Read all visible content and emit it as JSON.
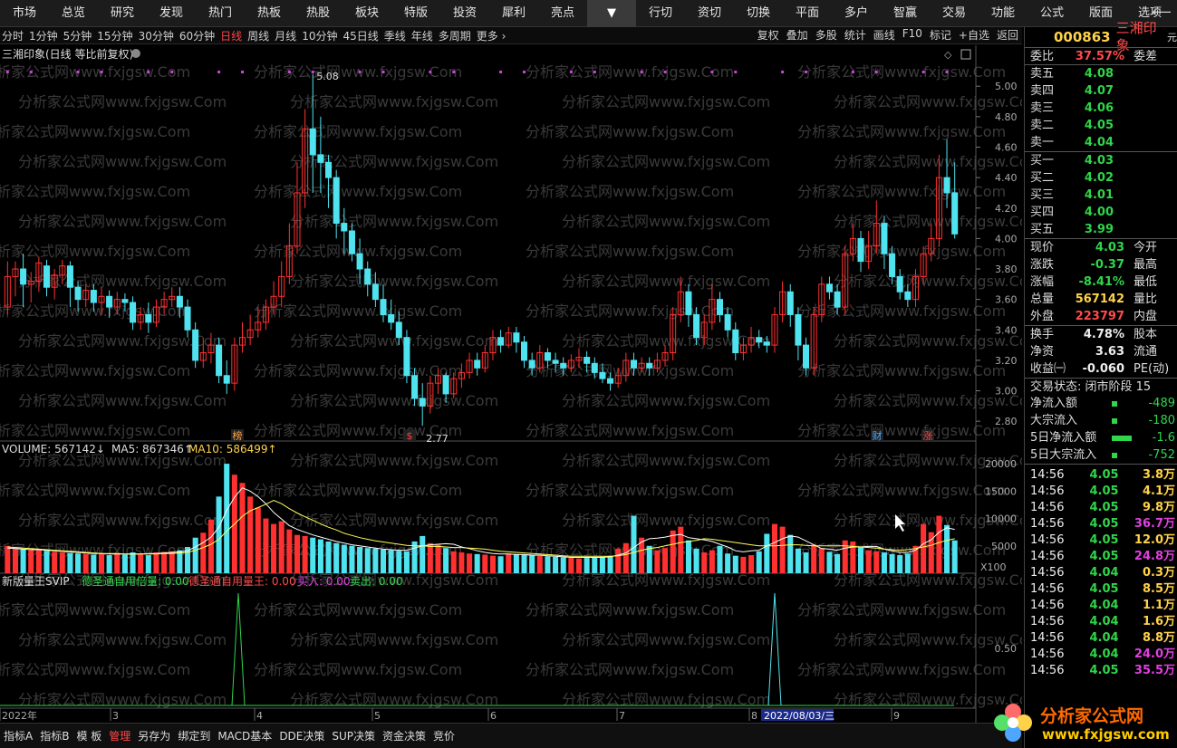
{
  "menu": [
    "市场",
    "总览",
    "研究",
    "发现",
    "热门",
    "热板",
    "热股",
    "板块",
    "特版",
    "投资",
    "犀利",
    "亮点",
    "▼",
    "行切",
    "资切",
    "切换",
    "平面",
    "多户",
    "智赢",
    "交易",
    "功能",
    "公式",
    "版面",
    "选项"
  ],
  "periods": [
    "分时",
    "1分钟",
    "5分钟",
    "15分钟",
    "30分钟",
    "60分钟",
    "日线",
    "周线",
    "月线",
    "10分钟",
    "45日线",
    "季线",
    "年线",
    "多周期",
    "更多 ›"
  ],
  "active_period": "日线",
  "period_right": [
    "复权",
    "叠加",
    "多股",
    "统计",
    "画线",
    "F10",
    "标记",
    "+自选",
    "返回"
  ],
  "title": "三湘印象(日线 等比前复权)",
  "watermark": "分析家公式网www.fxjgsw.Com",
  "markers": {
    "hi": "5.08",
    "lo": "2.77",
    "m1": "榜",
    "m2": "$",
    "m3": "财",
    "m4": "涨"
  },
  "volume_legend": {
    "vol": "VOLUME: 567142↓",
    "ma5": "MA5: 867346↑",
    "ma10": "MA10: 586499↑"
  },
  "x100": "X100",
  "ind_legend": {
    "name": "新版量王SVIP",
    "a": "德圣通自用倍量: 0.00",
    "b": "德圣通自用量王: 0.00",
    "c": "买入: 0.00",
    "d": "卖出: 0.00"
  },
  "ind_tick": "0.50",
  "xaxis": {
    "y": "2022年",
    "m3": "3",
    "m4": "4",
    "m5": "5",
    "m6": "6",
    "m7": "7",
    "m8": "8",
    "m9": "9",
    "date": "2022/08/03/三"
  },
  "price_ticks": [
    "5.00",
    "4.80",
    "4.60",
    "4.40",
    "4.20",
    "4.00",
    "3.80",
    "3.60",
    "3.40",
    "3.20",
    "3.00",
    "2.80"
  ],
  "vol_ticks": [
    "20000",
    "15000",
    "10000",
    "5000"
  ],
  "bottom": [
    "指标A",
    "指标B",
    "模 板",
    "管理",
    "另存为",
    "绑定到",
    "MACD基本",
    "DDE决策",
    "SUP决策",
    "资金决策",
    "竞价"
  ],
  "bottom_active": "管理",
  "quote": {
    "code": "000863",
    "name": "三湘印象",
    "unit": "元",
    "wb_l": "委比",
    "wb_v": "37.57%",
    "wc_l": "委差",
    "asks": [
      {
        "l": "卖五",
        "p": "4.08"
      },
      {
        "l": "卖四",
        "p": "4.07"
      },
      {
        "l": "卖三",
        "p": "4.06"
      },
      {
        "l": "卖二",
        "p": "4.05"
      },
      {
        "l": "卖一",
        "p": "4.04"
      }
    ],
    "bids": [
      {
        "l": "买一",
        "p": "4.03"
      },
      {
        "l": "买二",
        "p": "4.02"
      },
      {
        "l": "买三",
        "p": "4.01"
      },
      {
        "l": "买四",
        "p": "4.00"
      },
      {
        "l": "买五",
        "p": "3.99"
      }
    ],
    "stats": [
      {
        "l": "现价",
        "v": "4.03",
        "c": "g",
        "r": "今开"
      },
      {
        "l": "涨跌",
        "v": "-0.37",
        "c": "g",
        "r": "最高"
      },
      {
        "l": "涨幅",
        "v": "-8.41%",
        "c": "g",
        "r": "最低"
      },
      {
        "l": "总量",
        "v": "567142",
        "c": "y",
        "r": "量比"
      },
      {
        "l": "外盘",
        "v": "223797",
        "c": "r",
        "r": "内盘"
      },
      {
        "l": "换手",
        "v": "4.78%",
        "c": "w",
        "r": "股本"
      },
      {
        "l": "净资",
        "v": "3.63",
        "c": "w",
        "r": "流通"
      },
      {
        "l": "收益㈠",
        "v": "-0.060",
        "c": "w",
        "r": "PE(动)"
      }
    ],
    "status": "交易状态: 闭市阶段 15",
    "flows": [
      {
        "l": "净流入额",
        "v": "-489"
      },
      {
        "l": "大宗流入",
        "v": "-180"
      },
      {
        "l": "5日净流入额",
        "v": "-1.6"
      },
      {
        "l": "5日大宗流入",
        "v": "-752"
      }
    ],
    "ticks": [
      {
        "t": "14:56",
        "p": "4.05",
        "v": "3.8万",
        "c": "y"
      },
      {
        "t": "14:56",
        "p": "4.05",
        "v": "4.1万",
        "c": "y"
      },
      {
        "t": "14:56",
        "p": "4.05",
        "v": "9.8万",
        "c": "y"
      },
      {
        "t": "14:56",
        "p": "4.05",
        "v": "36.7万",
        "c": "m"
      },
      {
        "t": "14:56",
        "p": "4.05",
        "v": "12.0万",
        "c": "y"
      },
      {
        "t": "14:56",
        "p": "4.05",
        "v": "24.8万",
        "c": "m"
      },
      {
        "t": "14:56",
        "p": "4.04",
        "v": "0.3万",
        "c": "y"
      },
      {
        "t": "14:56",
        "p": "4.05",
        "v": "8.5万",
        "c": "y"
      },
      {
        "t": "14:56",
        "p": "4.04",
        "v": "1.1万",
        "c": "y"
      },
      {
        "t": "14:56",
        "p": "4.04",
        "v": "1.6万",
        "c": "y"
      },
      {
        "t": "14:56",
        "p": "4.04",
        "v": "8.8万",
        "c": "y"
      },
      {
        "t": "14:56",
        "p": "4.04",
        "v": "24.0万",
        "c": "m"
      },
      {
        "t": "14:56",
        "p": "4.05",
        "v": "35.5万",
        "c": "m"
      }
    ]
  },
  "logo": {
    "cn": "分析家公式网",
    "url": "www.fxjgsw.com"
  },
  "colors": {
    "up": "#ff3030",
    "down": "#4fe3f0",
    "ma5": "#ffffff",
    "ma10": "#ffd200",
    "volma10": "#ffff55"
  },
  "chart_data": {
    "type": "candlestick",
    "price_range": [
      2.7,
      5.15
    ],
    "candles": [
      [
        3.55,
        3.75,
        3.85,
        3.5
      ],
      [
        3.75,
        3.8,
        3.85,
        3.62
      ],
      [
        3.8,
        3.7,
        3.9,
        3.55
      ],
      [
        3.7,
        3.72,
        3.78,
        3.58
      ],
      [
        3.72,
        3.84,
        3.88,
        3.65
      ],
      [
        3.82,
        3.68,
        3.86,
        3.62
      ],
      [
        3.68,
        3.76,
        3.8,
        3.6
      ],
      [
        3.76,
        3.82,
        3.86,
        3.7
      ],
      [
        3.82,
        3.68,
        3.85,
        3.55
      ],
      [
        3.68,
        3.6,
        3.72,
        3.52
      ],
      [
        3.6,
        3.66,
        3.7,
        3.55
      ],
      [
        3.66,
        3.58,
        3.7,
        3.52
      ],
      [
        3.58,
        3.62,
        3.68,
        3.5
      ],
      [
        3.62,
        3.55,
        3.66,
        3.48
      ],
      [
        3.55,
        3.6,
        3.65,
        3.5
      ],
      [
        3.6,
        3.58,
        3.64,
        3.52
      ],
      [
        3.58,
        3.45,
        3.62,
        3.4
      ],
      [
        3.45,
        3.5,
        3.55,
        3.4
      ],
      [
        3.5,
        3.45,
        3.58,
        3.38
      ],
      [
        3.45,
        3.55,
        3.6,
        3.42
      ],
      [
        3.55,
        3.6,
        3.65,
        3.5
      ],
      [
        3.6,
        3.62,
        3.68,
        3.55
      ],
      [
        3.62,
        3.55,
        3.68,
        3.48
      ],
      [
        3.55,
        3.4,
        3.6,
        3.35
      ],
      [
        3.4,
        3.2,
        3.45,
        3.15
      ],
      [
        3.2,
        3.25,
        3.35,
        3.15
      ],
      [
        3.25,
        3.3,
        3.38,
        3.18
      ],
      [
        3.3,
        3.1,
        3.35,
        3.05
      ],
      [
        3.1,
        3.05,
        3.2,
        2.98
      ],
      [
        3.05,
        3.3,
        3.35,
        3.0
      ],
      [
        3.3,
        3.35,
        3.45,
        3.25
      ],
      [
        3.35,
        3.4,
        3.5,
        3.3
      ],
      [
        3.4,
        3.45,
        3.55,
        3.35
      ],
      [
        3.45,
        3.55,
        3.6,
        3.4
      ],
      [
        3.55,
        3.62,
        3.72,
        3.5
      ],
      [
        3.62,
        3.75,
        3.85,
        3.55
      ],
      [
        3.75,
        3.95,
        4.1,
        3.7
      ],
      [
        3.95,
        4.3,
        4.5,
        3.9
      ],
      [
        4.3,
        4.72,
        4.85,
        4.2
      ],
      [
        4.72,
        4.55,
        5.08,
        4.3
      ],
      [
        4.55,
        4.5,
        4.8,
        4.3
      ],
      [
        4.5,
        4.4,
        4.55,
        4.2
      ],
      [
        4.4,
        4.1,
        4.45,
        4.0
      ],
      [
        4.1,
        4.05,
        4.2,
        3.9
      ],
      [
        4.05,
        3.9,
        4.1,
        3.85
      ],
      [
        3.9,
        3.8,
        4.0,
        3.7
      ],
      [
        3.8,
        3.7,
        3.85,
        3.62
      ],
      [
        3.7,
        3.6,
        3.78,
        3.55
      ],
      [
        3.6,
        3.5,
        3.7,
        3.45
      ],
      [
        3.5,
        3.45,
        3.6,
        3.4
      ],
      [
        3.45,
        3.35,
        3.52,
        3.3
      ],
      [
        3.35,
        3.1,
        3.4,
        3.05
      ],
      [
        3.1,
        2.95,
        3.15,
        2.9
      ],
      [
        2.95,
        2.9,
        3.05,
        2.77
      ],
      [
        2.9,
        3.05,
        3.1,
        2.85
      ],
      [
        3.05,
        3.1,
        3.15,
        2.98
      ],
      [
        3.1,
        2.98,
        3.12,
        2.92
      ],
      [
        2.98,
        3.08,
        3.12,
        2.95
      ],
      [
        3.08,
        3.12,
        3.18,
        3.02
      ],
      [
        3.12,
        3.2,
        3.25,
        3.08
      ],
      [
        3.2,
        3.15,
        3.25,
        3.1
      ],
      [
        3.15,
        3.25,
        3.3,
        3.12
      ],
      [
        3.25,
        3.35,
        3.4,
        3.2
      ],
      [
        3.35,
        3.3,
        3.4,
        3.25
      ],
      [
        3.3,
        3.38,
        3.42,
        3.28
      ],
      [
        3.38,
        3.32,
        3.42,
        3.25
      ],
      [
        3.32,
        3.2,
        3.36,
        3.15
      ],
      [
        3.2,
        3.15,
        3.25,
        3.1
      ],
      [
        3.15,
        3.25,
        3.3,
        3.12
      ],
      [
        3.25,
        3.2,
        3.28,
        3.15
      ],
      [
        3.2,
        3.18,
        3.25,
        3.12
      ],
      [
        3.18,
        3.15,
        3.22,
        3.1
      ],
      [
        3.15,
        3.2,
        3.24,
        3.12
      ],
      [
        3.2,
        3.22,
        3.28,
        3.15
      ],
      [
        3.22,
        3.18,
        3.26,
        3.12
      ],
      [
        3.18,
        3.12,
        3.22,
        3.08
      ],
      [
        3.12,
        3.08,
        3.18,
        3.05
      ],
      [
        3.08,
        3.05,
        3.12,
        3.0
      ],
      [
        3.05,
        3.1,
        3.15,
        3.02
      ],
      [
        3.1,
        3.2,
        3.25,
        3.06
      ],
      [
        3.2,
        3.15,
        3.25,
        3.1
      ],
      [
        3.15,
        3.18,
        3.22,
        3.12
      ],
      [
        3.18,
        3.15,
        3.22,
        3.1
      ],
      [
        3.15,
        3.2,
        3.25,
        3.12
      ],
      [
        3.2,
        3.25,
        3.3,
        3.16
      ],
      [
        3.25,
        3.5,
        3.55,
        3.2
      ],
      [
        3.5,
        3.65,
        3.75,
        3.45
      ],
      [
        3.65,
        3.5,
        3.7,
        3.42
      ],
      [
        3.5,
        3.35,
        3.55,
        3.3
      ],
      [
        3.35,
        3.45,
        3.5,
        3.3
      ],
      [
        3.45,
        3.6,
        3.7,
        3.4
      ],
      [
        3.6,
        3.5,
        3.65,
        3.45
      ],
      [
        3.5,
        3.4,
        3.55,
        3.35
      ],
      [
        3.4,
        3.25,
        3.45,
        3.2
      ],
      [
        3.25,
        3.3,
        3.35,
        3.2
      ],
      [
        3.3,
        3.35,
        3.42,
        3.25
      ],
      [
        3.35,
        3.32,
        3.4,
        3.28
      ],
      [
        3.32,
        3.3,
        3.36,
        3.25
      ],
      [
        3.3,
        3.5,
        3.55,
        3.25
      ],
      [
        3.5,
        3.65,
        3.72,
        3.45
      ],
      [
        3.65,
        3.5,
        3.7,
        3.42
      ],
      [
        3.5,
        3.3,
        3.55,
        3.2
      ],
      [
        3.3,
        3.15,
        3.35,
        3.1
      ],
      [
        3.15,
        3.5,
        3.55,
        3.1
      ],
      [
        3.5,
        3.7,
        3.75,
        3.45
      ],
      [
        3.7,
        3.65,
        3.75,
        3.6
      ],
      [
        3.65,
        3.55,
        3.7,
        3.5
      ],
      [
        3.55,
        3.9,
        3.95,
        3.5
      ],
      [
        3.9,
        4.0,
        4.1,
        3.85
      ],
      [
        4.0,
        3.85,
        4.05,
        3.78
      ],
      [
        3.85,
        3.95,
        4.05,
        3.8
      ],
      [
        3.95,
        4.1,
        4.25,
        3.9
      ],
      [
        4.1,
        3.9,
        4.15,
        3.8
      ],
      [
        3.9,
        3.75,
        3.95,
        3.7
      ],
      [
        3.75,
        3.65,
        3.8,
        3.6
      ],
      [
        3.65,
        3.6,
        3.7,
        3.55
      ],
      [
        3.6,
        3.75,
        3.8,
        3.55
      ],
      [
        3.75,
        3.9,
        3.95,
        3.7
      ],
      [
        3.9,
        4.0,
        4.1,
        3.85
      ],
      [
        4.0,
        4.4,
        4.55,
        3.95
      ],
      [
        4.4,
        4.3,
        4.65,
        4.2
      ],
      [
        4.3,
        4.03,
        4.5,
        4.0
      ]
    ],
    "volume": [
      5000,
      4600,
      4400,
      4200,
      4300,
      4100,
      3900,
      3800,
      3700,
      3600,
      3500,
      3400,
      3600,
      3300,
      3500,
      3400,
      3800,
      3600,
      3300,
      3800,
      3900,
      4000,
      4200,
      4800,
      6500,
      7400,
      9800,
      14000,
      20000,
      18000,
      16500,
      14000,
      12000,
      10000,
      9000,
      9500,
      8000,
      7000,
      6800,
      6500,
      6200,
      5800,
      5500,
      5200,
      5000,
      4800,
      4600,
      4500,
      4300,
      4200,
      4100,
      4000,
      5800,
      6800,
      5500,
      5200,
      4600,
      4000,
      3800,
      3600,
      3500,
      3400,
      3200,
      3100,
      3600,
      3500,
      3400,
      3300,
      3200,
      3100,
      3000,
      2900,
      2800,
      2700,
      2800,
      2900,
      3000,
      3100,
      4500,
      5500,
      10500,
      6500,
      5000,
      4200,
      4600,
      7800,
      8500,
      6000,
      4500,
      3800,
      4200,
      5000,
      3600,
      3200,
      3000,
      3300,
      4000,
      7200,
      9000,
      8500,
      7000,
      4500,
      3800,
      5200,
      4600,
      3900,
      3500,
      6000,
      5800,
      4800,
      4200,
      4000,
      3800,
      3500,
      3300,
      3600,
      5000,
      9000,
      7500,
      10500,
      8800,
      6000
    ],
    "vol_ma5": [
      4600,
      4500,
      4400,
      4300,
      4300,
      4200,
      4100,
      4000,
      3900,
      3800,
      3700,
      3600,
      3600,
      3500,
      3500,
      3500,
      3500,
      3500,
      3600,
      3600,
      3700,
      3800,
      3900,
      4100,
      4800,
      5600,
      6600,
      8400,
      11500,
      13900,
      15600,
      15000,
      14000,
      12700,
      11100,
      9900,
      8700,
      8000,
      7500,
      7000,
      6600,
      6200,
      5800,
      5500,
      5200,
      5000,
      4800,
      4600,
      4400,
      4300,
      4200,
      4200,
      4600,
      5000,
      5200,
      5300,
      5400,
      5300,
      4800,
      4500,
      4100,
      3800,
      3600,
      3500,
      3500,
      3400,
      3400,
      3300,
      3300,
      3200,
      3100,
      3000,
      2900,
      2900,
      2900,
      2900,
      2900,
      3000,
      3300,
      3700,
      4700,
      5700,
      6300,
      6400,
      6600,
      6900,
      7100,
      6500,
      6300,
      6100,
      5800,
      5300,
      4800,
      4100,
      3900,
      4100,
      4200,
      5000,
      5600,
      6300,
      6800,
      6600,
      5900,
      5200,
      4500,
      4400,
      4200,
      4600,
      4800,
      4800,
      4900,
      4900,
      4400,
      4100,
      3800,
      3800,
      4200,
      5400,
      6100,
      7500,
      8300,
      8000
    ],
    "vol_ma10": [
      4800,
      4700,
      4600,
      4500,
      4400,
      4300,
      4200,
      4100,
      4000,
      3900,
      3800,
      3700,
      3600,
      3600,
      3600,
      3500,
      3500,
      3500,
      3500,
      3500,
      3600,
      3600,
      3700,
      3800,
      4200,
      4700,
      5300,
      6200,
      7700,
      9000,
      10400,
      11400,
      12000,
      12600,
      13300,
      12700,
      11800,
      11000,
      10300,
      9700,
      9000,
      8400,
      7900,
      7300,
      6900,
      6500,
      6200,
      5900,
      5700,
      5500,
      5300,
      5100,
      5000,
      5000,
      4900,
      4900,
      4800,
      4700,
      4700,
      4600,
      4500,
      4400,
      4200,
      4000,
      3900,
      3800,
      3700,
      3600,
      3500,
      3400,
      3300,
      3200,
      3100,
      3100,
      3100,
      3100,
      3100,
      3100,
      3200,
      3400,
      3800,
      4200,
      4500,
      4700,
      5000,
      5300,
      5600,
      5800,
      6000,
      6300,
      6200,
      6000,
      5800,
      5600,
      5400,
      5200,
      5000,
      5000,
      5000,
      5100,
      5200,
      5200,
      5100,
      5000,
      5000,
      5000,
      5000,
      5000,
      4900,
      4800,
      4700,
      4600,
      4400,
      4300,
      4200,
      4300,
      4500,
      4800,
      5100,
      5600,
      6000,
      6300
    ]
  }
}
